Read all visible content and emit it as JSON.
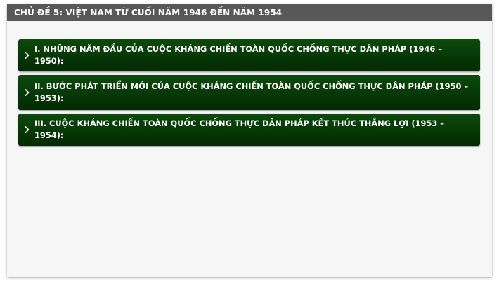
{
  "panel": {
    "title": "CHỦ ĐỀ 5: VIỆT NAM TỪ CUỐI NĂM 1946 ĐẾN NĂM 1954"
  },
  "accordion": {
    "items": [
      {
        "label": "I. NHỮNG NĂM ĐẦU CỦA CUỘC KHÁNG CHIẾN TOÀN QUỐC CHỐNG THỰC DÂN PHÁP (1946 – 1950):",
        "icon": "chevron-right-icon",
        "expanded": false
      },
      {
        "label": "II. BƯỚC PHÁT TRIỂN MỚI CỦA CUỘC KHÁNG CHIẾN TOÀN QUỐC CHỐNG THỰC DÂN PHÁP (1950 – 1953):",
        "icon": "chevron-right-icon",
        "expanded": false
      },
      {
        "label": "III. CUỘC KHÁNG CHIẾN TOÀN QUỐC CHỐNG THỰC DÂN PHÁP KẾT THÚC THẮNG LỢI (1953 – 1954):",
        "icon": "chevron-right-icon",
        "expanded": false
      }
    ]
  },
  "colors": {
    "header_bg": "#585858",
    "item_bg": "#063806",
    "panel_bg": "#f6f6f6",
    "text": "#ffffff"
  }
}
